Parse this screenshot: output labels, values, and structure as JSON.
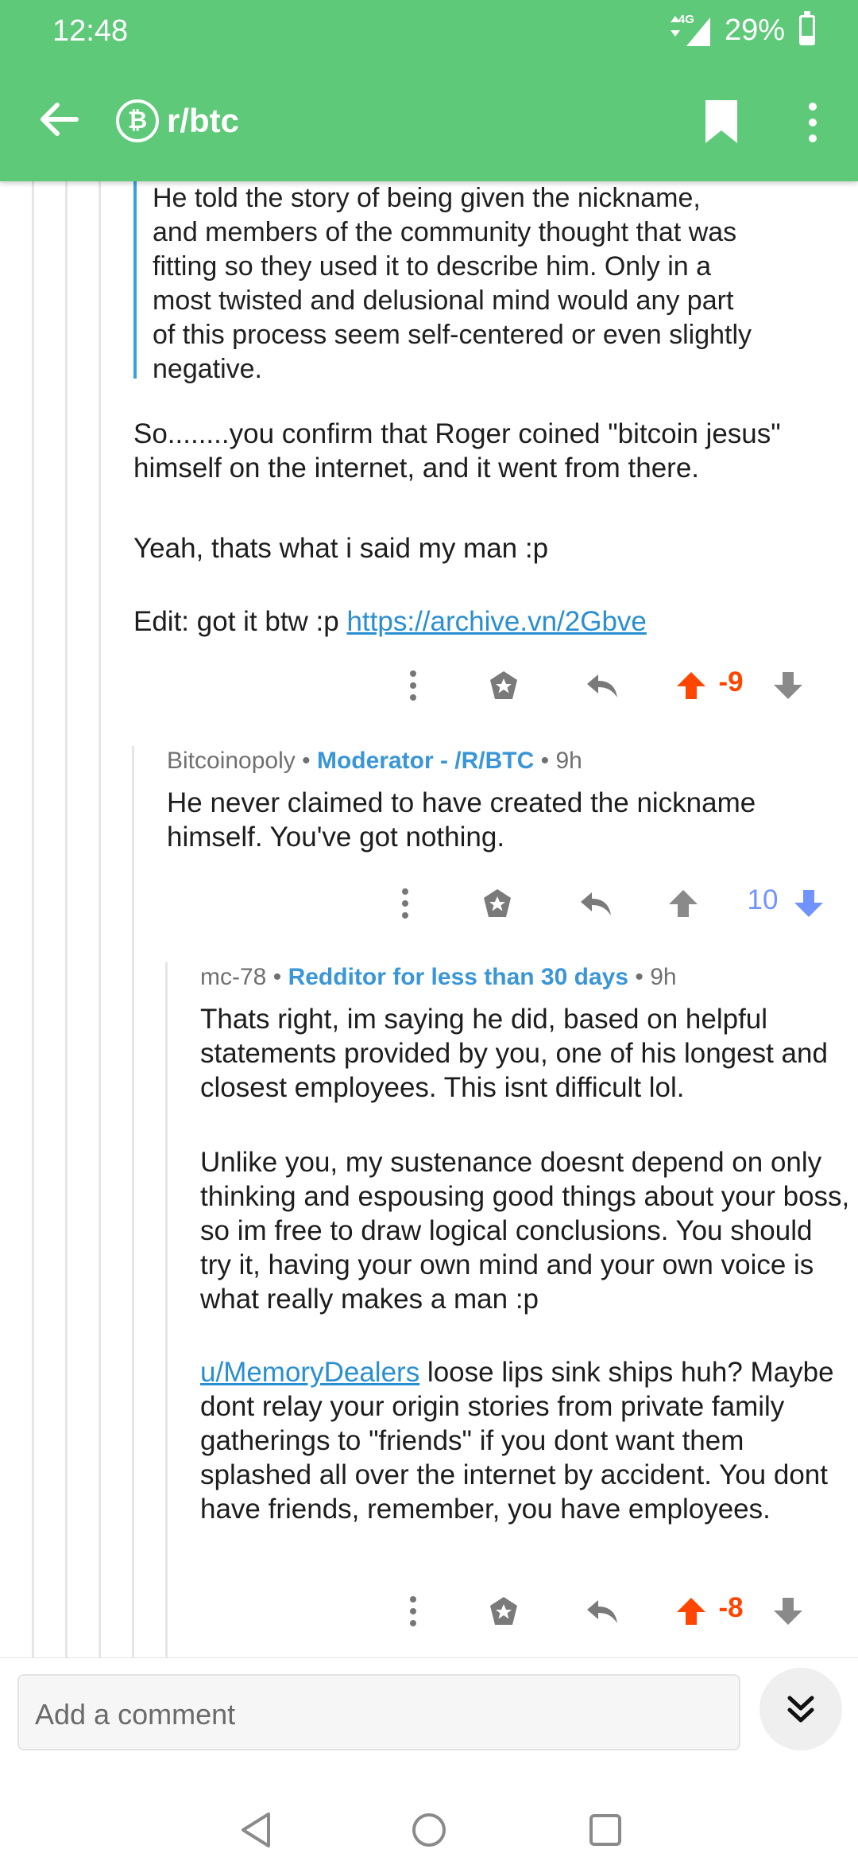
{
  "status": {
    "time": "12:48",
    "battery": "29%",
    "battery_level": 0.29,
    "network": "4G"
  },
  "header": {
    "subreddit": "r/btc",
    "sub_icon_glyph": "₿"
  },
  "quote_text": "He told the story of being given the nickname,\nand members of the community thought that was\nfitting so they used it to describe him. Only in a\nmost twisted and delusional mind would any part\nof this process seem self-centered or even slightly\nnegative.",
  "comment1": {
    "para1": "So........you confirm that Roger coined \"bitcoin jesus\" himself on the internet, and it went from there.",
    "para2": "Yeah, thats what i said my man :p",
    "para3_prefix": "Edit: got it btw :p ",
    "link": "https://archive.vn/2Gbve",
    "score": "-9"
  },
  "comment2": {
    "author": "Bitcoinopoly",
    "sep": "•",
    "flair": "Moderator - /R/BTC",
    "time": "9h",
    "body": "He never claimed to have created the nickname himself. You've got nothing.",
    "score": "10"
  },
  "comment3": {
    "author": "mc-78",
    "sep": "•",
    "flair": "Redditor for less than 30 days",
    "time": "9h",
    "para1": "Thats right, im saying he did, based on helpful statements provided by you, one of his longest and closest employees. This isnt difficult lol.",
    "para2": "Unlike you, my sustenance doesnt depend on only thinking and espousing good things about your boss, so im free to draw logical conclusions. You should try it, having your own mind and your own voice is what really makes a man :p",
    "mention": "u/MemoryDealers",
    "para3_rest": " loose lips sink ships huh? Maybe dont relay your origin stories from private family gatherings to \"friends\" if you dont want them splashed all over the internet by accident. You dont have friends, remember, you have employees.",
    "score": "-8"
  },
  "comment_box": {
    "placeholder": "Add a comment"
  },
  "colors": {
    "header": "#5ec979",
    "upvote": "#ff4500",
    "downvote": "#7193ff",
    "neutral": "#8a8a8a",
    "link": "#2a8fd0",
    "flair": "#3a96d6"
  },
  "icons": [
    "back-arrow-icon",
    "bitcoin-icon",
    "bookmark-icon",
    "more-vertical-icon",
    "award-icon",
    "reply-icon",
    "upvote-icon",
    "downvote-icon",
    "double-chevron-down-icon",
    "nav-back-icon",
    "nav-home-icon",
    "nav-recents-icon"
  ]
}
